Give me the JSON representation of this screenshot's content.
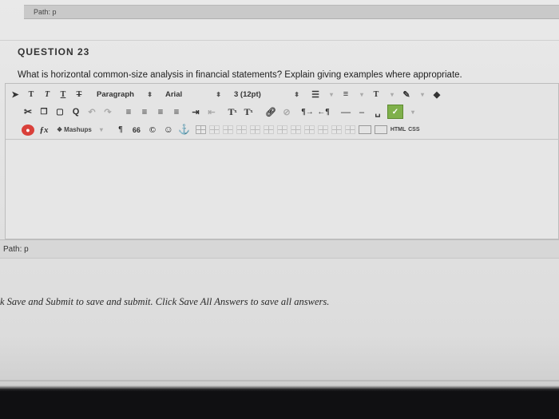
{
  "top_path": {
    "label": "Path: p"
  },
  "question": {
    "heading": "QUESTION 23",
    "text": "What is horizontal common-size analysis in financial statements? Explain giving examples where appropriate."
  },
  "toolbar": {
    "row1": {
      "text_buttons": [
        "T",
        "T",
        "T",
        "T"
      ],
      "paragraph_select": "Paragraph",
      "font_select": "Arial",
      "size_select": "3 (12pt)",
      "text_color_label": "T"
    },
    "row2": {
      "superscript_label": "T",
      "subscript_label": "T"
    },
    "row3": {
      "mashups_label": "Mashups",
      "paragraph_mark": "¶",
      "quote_mark": "66",
      "html_label": "HTML",
      "css_label": "CSS"
    }
  },
  "bottom_path": {
    "label": "Path: p"
  },
  "instruction": {
    "text": "k Save and Submit to save and submit. Click Save All Answers to save all answers."
  }
}
